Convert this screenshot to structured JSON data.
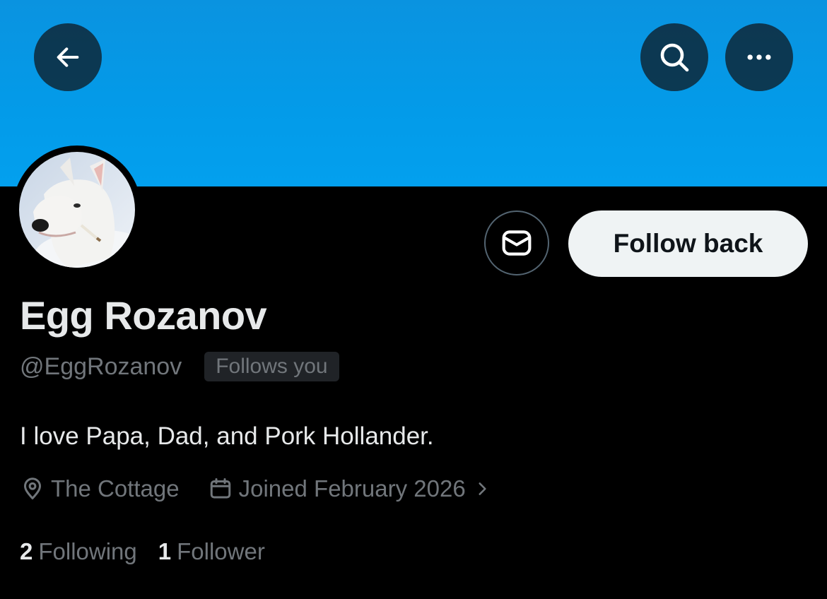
{
  "header": {
    "back_icon": "arrow-left-icon",
    "search_icon": "search-icon",
    "more_icon": "more-horizontal-icon",
    "banner_color": "#039be9"
  },
  "profile": {
    "avatar_description_icon": "avatar",
    "display_name": "Egg Rozanov",
    "handle": "@EggRozanov",
    "follows_you_label": "Follows you",
    "bio": "I love Papa, Dad, and Pork Hollander.",
    "location": "The Cottage",
    "joined": "Joined February 2026",
    "following_count": "2",
    "following_label": "Following",
    "followers_count": "1",
    "followers_label": "Follower"
  },
  "actions": {
    "message_icon": "message-icon",
    "follow_back_label": "Follow back"
  },
  "colors": {
    "background": "#000000",
    "text_primary": "#e7e9ea",
    "text_secondary": "#71767b",
    "button_light": "#eff3f4"
  }
}
